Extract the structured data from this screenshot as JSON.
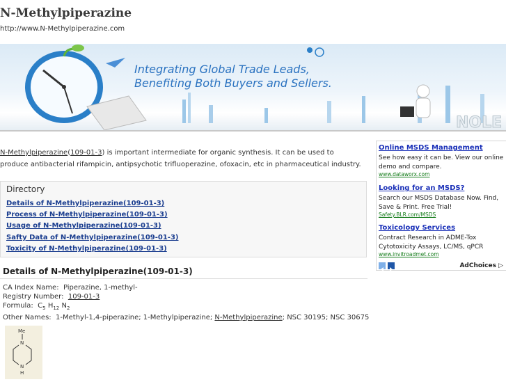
{
  "header": {
    "title": "N-Methylpiperazine",
    "url": "http://www.N-Methylpiperazine.com"
  },
  "banner": {
    "line1": "Integrating Global Trade Leads,",
    "line2": "Benefiting Both Buyers and Sellers."
  },
  "intro": {
    "name_link": "N-Methylpiperazine",
    "cas_link": "109-01-3",
    "text": " is important intermediate for organic synthesis.  It can be used to produce antibacterial rifampicin, antipsychotic trifluoperazine, ofoxacin, etc in pharmaceutical industry."
  },
  "directory": {
    "heading": "Directory",
    "links": [
      "Details of N-Methylpiperazine(109-01-3)",
      "Process of N-Methylpiperazine(109-01-3)",
      "Usage of N-Methylpiperazine(109-01-3)",
      "Safty Data of N-Methylpiperazine(109-01-3)",
      "Toxicity of N-Methylpiperazine(109-01-3)"
    ]
  },
  "details": {
    "heading": "Details of N-Methylpiperazine(109-01-3)",
    "ca_index_label": "CA Index Name:",
    "ca_index_value": "Piperazine, 1-methyl-",
    "registry_label": "Registry Number:",
    "registry_value": "109-01-3",
    "formula_label": "Formula:",
    "formula": {
      "c": "C",
      "c_n": "5",
      "h": "H",
      "h_n": "12",
      "n": "N",
      "n_n": "2"
    },
    "other_names_label": "Other Names:",
    "other_names_pre": "1-Methyl-1,4-piperazine; 1-Methylpiperazine;",
    "other_names_link": "N-Methylpiperazine",
    "other_names_post": "; NSC 30195; NSC 30675",
    "structure_labels": {
      "me": "Me",
      "n1": "N",
      "n2": "N",
      "h": "H"
    }
  },
  "ads": {
    "items": [
      {
        "title": "Online MSDS Management",
        "body": "See how easy it can be. View our online demo and compare.",
        "url": "www.dataworx.com"
      },
      {
        "title": "Looking for an MSDS?",
        "body": "Search our MSDS Database Now. Find, Save & Print. Free Trial!",
        "url": "Safety.BLR.com/MSDS"
      },
      {
        "title": "Toxicology Services",
        "body": "Contract Research in ADME-Tox Cytotoxicity Assays, LC/MS, qPCR",
        "url": "www.invitroadmet.com"
      }
    ],
    "adchoices": "AdChoices"
  },
  "colors": {
    "link_blue": "#1a3d8f",
    "ad_title": "#1a30b8",
    "ad_url": "#117a17",
    "banner_text": "#2a72c0"
  }
}
